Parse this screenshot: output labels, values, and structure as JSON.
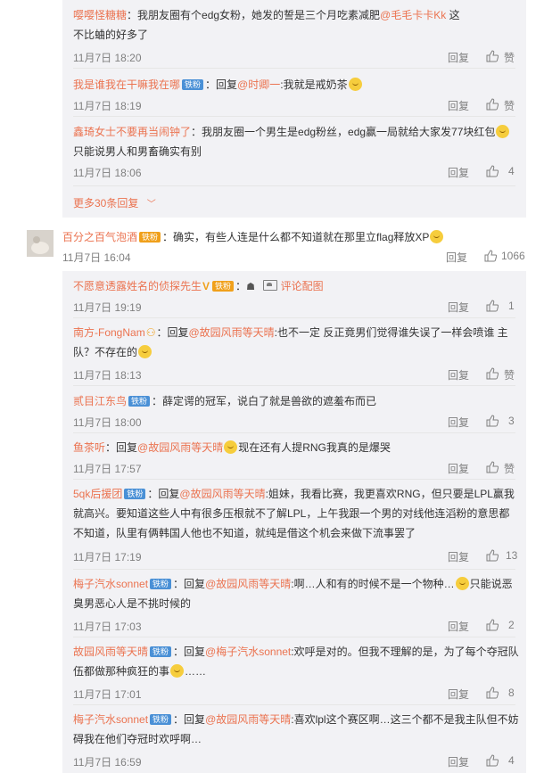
{
  "labels": {
    "reply": "回复",
    "like_word": "赞",
    "reply_to": "回复",
    "comment_pic": "评论配图"
  },
  "block1": {
    "items": [
      {
        "user": "嘤嘤怪糖糖",
        "text": "：我朋友圈有个edg女粉，她发的誓是三个月吃素减肥",
        "mention": "@毛毛卡卡Kk",
        "text2": " 这不比蛐的好多了",
        "time": "11月7日 18:20",
        "likes": "赞"
      },
      {
        "user": "我是谁我在干嘛我在哪",
        "badge": "铁粉",
        "prefix": "：回复",
        "mention": "@时卿一",
        "text": ":我就是戒奶茶",
        "time": "11月7日 18:19",
        "likes": "赞"
      },
      {
        "user": "鑫琦女士不要再当闹钟了",
        "text": "：我朋友圈一个男生是edg粉丝，edg赢一局就给大家发77块红包",
        "text2": "只能说男人和男畜确实有别",
        "time": "11月7日 18:06",
        "likes": "4"
      }
    ],
    "more": "更多30条回复"
  },
  "main_comment": {
    "user": "百分之百气泡酒",
    "badge": "铁粉",
    "text": "：确实，有些人连是什么都不知道就在那里立flag释放XP",
    "time": "11月7日 16:04",
    "likes": "1066"
  },
  "block2": {
    "items": [
      {
        "user": "不愿意透露姓名的侦探先生",
        "badge": "铁粉",
        "text": "：",
        "pic_label": "评论配图",
        "time": "11月7日 19:19",
        "likes": "1"
      },
      {
        "user": "南方-FongNam",
        "prefix": "：回复",
        "mention": "@故园风雨等天晴",
        "text": ":也不一定 反正竟男们觉得谁失误了一样会喷谁 主队？不存在的",
        "time": "11月7日 18:13",
        "likes": "赞"
      },
      {
        "user": "贰目江东鸟",
        "badge": "铁粉",
        "text": "：薛定谔的冠军，说白了就是兽欲的遮羞布而已",
        "time": "11月7日 18:00",
        "likes": "3"
      },
      {
        "user": "鱼茶听",
        "prefix": "：回复",
        "mention": "@故园风雨等天晴",
        "text": "现在还有人提RNG我真的是爆哭",
        "time": "11月7日 17:57",
        "likes": "赞"
      },
      {
        "user": "5qk后援团",
        "badge": "铁粉",
        "prefix": "：回复",
        "mention": "@故园风雨等天晴",
        "text": ":姐妹，我看比赛，我更喜欢RNG，但只要是LPL赢我就高兴。要知道这些人中有很多压根就不了解LPL，上午我跟一个男的对线他连滔粉的意思都不知道，队里有俩韩国人他也不知道，就纯是借这个机会来做下流事罢了",
        "time": "11月7日 17:19",
        "likes": "13"
      },
      {
        "user": "梅子汽水sonnet",
        "badge": "铁粉",
        "prefix": "：回复",
        "mention": "@故园风雨等天晴",
        "text": ":啊…人和有的时候不是一个物种…",
        "text2": "只能说恶臭男恶心人是不挑时候的",
        "time": "11月7日 17:03",
        "likes": "2"
      },
      {
        "user": "故园风雨等天晴",
        "badge": "铁粉",
        "prefix": "：回复",
        "mention": "@梅子汽水sonnet",
        "text": ":欢呼是对的。但我不理解的是，为了每个夺冠队伍都做那种疯狂的事",
        "text2": "……",
        "time": "11月7日 17:01",
        "likes": "8"
      },
      {
        "user": "梅子汽水sonnet",
        "badge": "铁粉",
        "prefix": "：回复",
        "mention": "@故园风雨等天晴",
        "text": ":喜欢lpl这个赛区啊…这三个都不是我主队但不妨碍我在他们夺冠时欢呼啊…",
        "time": "11月7日 16:59",
        "likes": "4"
      }
    ]
  },
  "colors": {
    "accent": "#eb7350",
    "meta": "#808080",
    "panel": "#f2f2f5",
    "badge": "#4a90d6"
  }
}
